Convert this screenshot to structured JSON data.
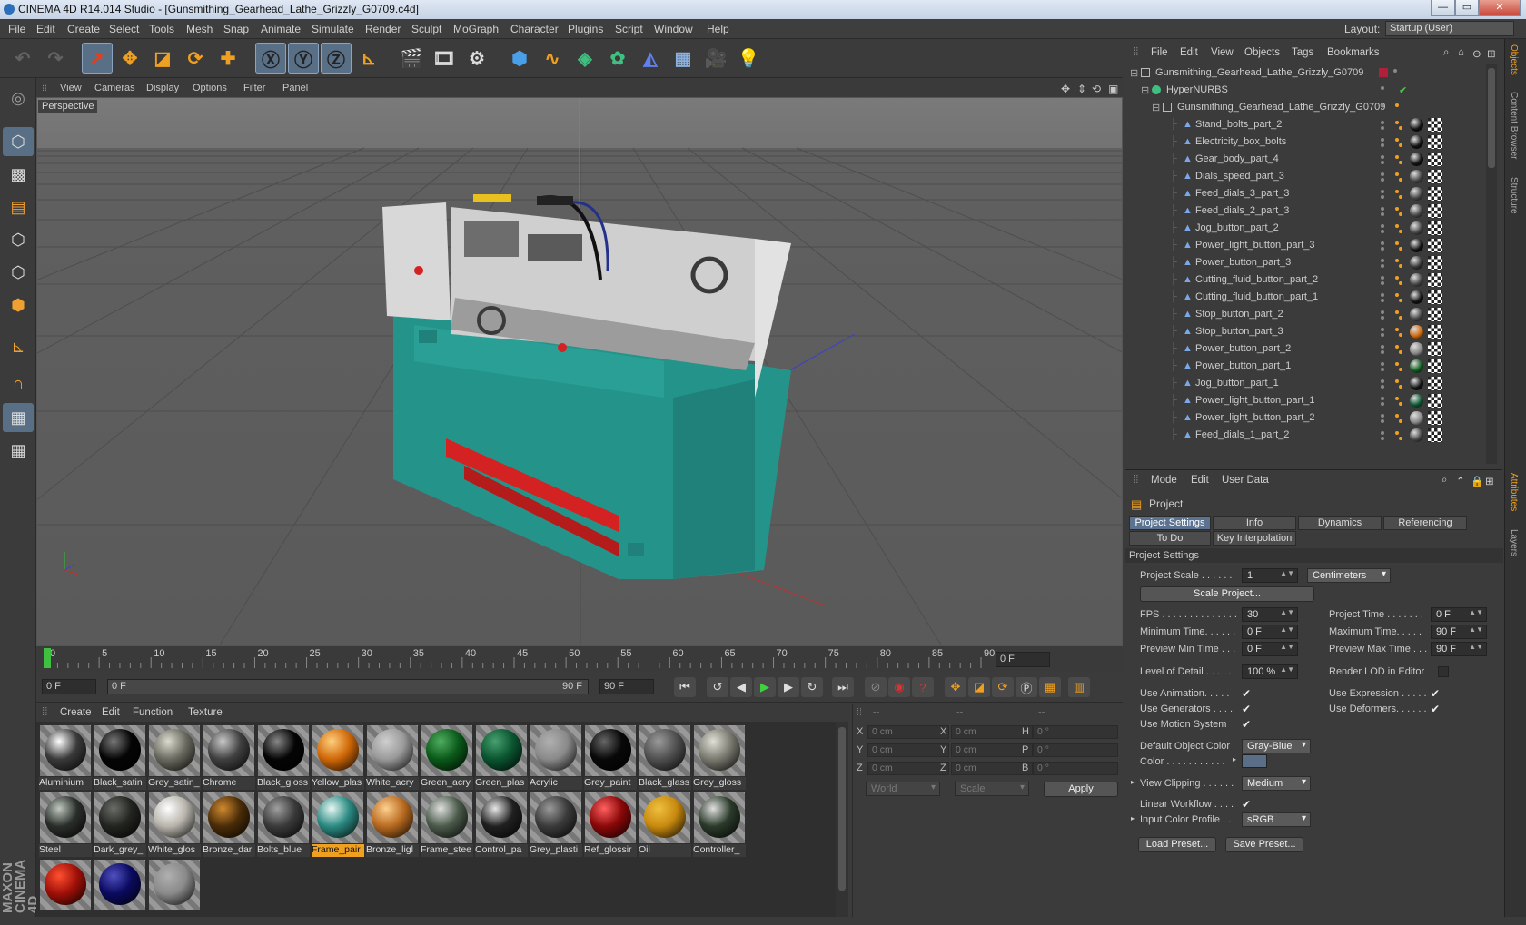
{
  "window": {
    "title": "CINEMA 4D R14.014 Studio - [Gunsmithing_Gearhead_Lathe_Grizzly_G0709.c4d]",
    "minimize": "—",
    "maximize": "▭",
    "close": "✕"
  },
  "menu": [
    "File",
    "Edit",
    "Create",
    "Select",
    "Tools",
    "Mesh",
    "Snap",
    "Animate",
    "Simulate",
    "Render",
    "Sculpt",
    "MoGraph",
    "Character",
    "Plugins",
    "Script",
    "Window",
    "Help"
  ],
  "layout": {
    "label": "Layout:",
    "value": "Startup (User)"
  },
  "toolbar": {
    "icons": [
      "undo-icon",
      "redo-icon",
      "select-arrow-icon",
      "move-icon",
      "scale-icon",
      "rotate-icon",
      "live-selection-icon",
      "x-axis-icon",
      "y-axis-icon",
      "z-axis-icon",
      "coordinate-system-icon",
      "render-view-icon",
      "render-picture-viewer-icon",
      "edit-render-settings-icon",
      "cube-icon",
      "bend-spline-icon",
      "generator-icon",
      "array-icon",
      "deformer-icon",
      "floor-icon",
      "camera-icon",
      "light-icon"
    ]
  },
  "viewport": {
    "menu": [
      "View",
      "Cameras",
      "Display",
      "Options",
      "Filter",
      "Panel"
    ],
    "label": "Perspective",
    "colors": {
      "sky": "#787878",
      "floor": "#5e5e5e",
      "body": "#2aa39a",
      "rails": "#d42222"
    }
  },
  "timeline": {
    "ticks": [
      "0",
      "5",
      "10",
      "15",
      "20",
      "25",
      "30",
      "35",
      "40",
      "45",
      "50",
      "55",
      "60",
      "65",
      "70",
      "75",
      "80",
      "85",
      "90"
    ],
    "current": "0 F"
  },
  "transport": {
    "start": "0 F",
    "range_start": "0 F",
    "range_end": "90 F",
    "end": "90 F"
  },
  "materials": {
    "menu": [
      "Create",
      "Edit",
      "Function",
      "Texture"
    ],
    "items": [
      {
        "name": "Aluminium",
        "color": "#3a3a3a",
        "hi": "#ffffff"
      },
      {
        "name": "Black_satin",
        "color": "#050505",
        "hi": "#777777"
      },
      {
        "name": "Grey_satin_",
        "color": "#6a6a60",
        "hi": "#dcdcd0"
      },
      {
        "name": "Chrome",
        "color": "#404040",
        "hi": "#c8c8c8"
      },
      {
        "name": "Black_gloss",
        "color": "#050505",
        "hi": "#888888"
      },
      {
        "name": "Yellow_plas",
        "color": "#d06808",
        "hi": "#ffd080"
      },
      {
        "name": "White_acry",
        "color": "#9a9a9a",
        "hi": "#cfcfcf"
      },
      {
        "name": "Green_acry",
        "color": "#0b5a1a",
        "hi": "#4fae5f"
      },
      {
        "name": "Green_plas",
        "color": "#0a5530",
        "hi": "#48a070"
      },
      {
        "name": "Acrylic",
        "color": "#8a8a8a",
        "hi": "#b0b0b0"
      },
      {
        "name": "Grey_paint",
        "color": "#080808",
        "hi": "#666666"
      },
      {
        "name": "Black_glass",
        "color": "#505050",
        "hi": "#9a9a9a"
      },
      {
        "name": "Grey_gloss",
        "color": "#7a7a70",
        "hi": "#e0e0d6"
      },
      {
        "name": "Steel",
        "color": "#2a2e2a",
        "hi": "#c0c8c0"
      },
      {
        "name": "Dark_grey_",
        "color": "#222420",
        "hi": "#6a6e68"
      },
      {
        "name": "White_glos",
        "color": "#b8b4ac",
        "hi": "#ffffff"
      },
      {
        "name": "Bronze_dar",
        "color": "#4a2c08",
        "hi": "#d08a30"
      },
      {
        "name": "Bolts_blue",
        "color": "#3a3a3a",
        "hi": "#a0a0a0"
      },
      {
        "name": "Frame_pair",
        "color": "#2a8a82",
        "hi": "#e8f8f4"
      },
      {
        "name": "Bronze_ligl",
        "color": "#b86a20",
        "hi": "#ffd090"
      },
      {
        "name": "Frame_stee",
        "color": "#4a5a4a",
        "hi": "#e0e0e0"
      },
      {
        "name": "Control_pa",
        "color": "#202020",
        "hi": "#e8e8e8"
      },
      {
        "name": "Grey_plasti",
        "color": "#3a3a3a",
        "hi": "#9a9a9a"
      },
      {
        "name": "Ref_glossir",
        "color": "#8a0808",
        "hi": "#ff6060"
      },
      {
        "name": "Oil",
        "color": "#c88a10",
        "hi": "#f0c040"
      },
      {
        "name": "Controller_",
        "color": "#2a3a2a",
        "hi": "#e0e0e0"
      },
      {
        "name": "",
        "color": "#a01008",
        "hi": "#ff5030"
      },
      {
        "name": "",
        "color": "#0a0a60",
        "hi": "#5050c0"
      },
      {
        "name": "",
        "color": "#8a8a8a",
        "hi": "#b0b0b0"
      }
    ]
  },
  "coords": {
    "header_a": "--",
    "header_b": "--",
    "header_c": "--",
    "rows": [
      {
        "a": "X",
        "av": "0 cm",
        "b": "X",
        "bv": "0 cm",
        "c": "H",
        "cv": "0 °"
      },
      {
        "a": "Y",
        "av": "0 cm",
        "b": "Y",
        "bv": "0 cm",
        "c": "P",
        "cv": "0 °"
      },
      {
        "a": "Z",
        "av": "0 cm",
        "b": "Z",
        "bv": "0 cm",
        "c": "B",
        "cv": "0 °"
      }
    ],
    "space": "World",
    "mode": "Scale",
    "apply": "Apply"
  },
  "objects": {
    "menu": [
      "File",
      "Edit",
      "View",
      "Objects",
      "Tags",
      "Bookmarks"
    ],
    "root": "Gunsmithing_Gearhead_Lathe_Grizzly_G0709",
    "nurbs": "HyperNURBS",
    "group": "Gunsmithing_Gearhead_Lathe_Grizzly_G0709",
    "items": [
      {
        "name": "Stand_bolts_part_2",
        "mat": "#111111"
      },
      {
        "name": "Electricity_box_bolts",
        "mat": "#111111"
      },
      {
        "name": "Gear_body_part_4",
        "mat": "#111111"
      },
      {
        "name": "Dials_speed_part_3",
        "mat": "#444444"
      },
      {
        "name": "Feed_dials_3_part_3",
        "mat": "#444444"
      },
      {
        "name": "Feed_dials_2_part_3",
        "mat": "#444444"
      },
      {
        "name": "Jog_button_part_2",
        "mat": "#444444"
      },
      {
        "name": "Power_light_button_part_3",
        "mat": "#111111"
      },
      {
        "name": "Power_button_part_3",
        "mat": "#333333"
      },
      {
        "name": "Cutting_fluid_button_part_2",
        "mat": "#444444"
      },
      {
        "name": "Cutting_fluid_button_part_1",
        "mat": "#111111"
      },
      {
        "name": "Stop_button_part_2",
        "mat": "#444444"
      },
      {
        "name": "Stop_button_part_3",
        "mat": "#d06808"
      },
      {
        "name": "Power_button_part_2",
        "mat": "#888888"
      },
      {
        "name": "Power_button_part_1",
        "mat": "#0b5a1a"
      },
      {
        "name": "Jog_button_part_1",
        "mat": "#111111"
      },
      {
        "name": "Power_light_button_part_1",
        "mat": "#0a5530"
      },
      {
        "name": "Power_light_button_part_2",
        "mat": "#888888"
      },
      {
        "name": "Feed_dials_1_part_2",
        "mat": "#444444"
      }
    ]
  },
  "attributes": {
    "menu": [
      "Mode",
      "Edit",
      "User Data"
    ],
    "title": "Project",
    "tabs": [
      "Project Settings",
      "Info",
      "Dynamics",
      "Referencing"
    ],
    "tabs2": [
      "To Do",
      "Key Interpolation"
    ],
    "section": "Project Settings",
    "project_scale": {
      "label": "Project Scale . . . . . .",
      "value": "1",
      "unit": "Centimeters"
    },
    "scale_button": "Scale Project...",
    "fps": {
      "label": "FPS . . . . . . . . . . . . . .",
      "value": "30"
    },
    "project_time": {
      "label": "Project Time . . . . . . .",
      "value": "0 F"
    },
    "min_time": {
      "label": "Minimum Time. . . . . .",
      "value": "0 F"
    },
    "max_time": {
      "label": "Maximum Time. . . . .",
      "value": "90 F"
    },
    "prev_min": {
      "label": "Preview Min Time . . .",
      "value": "0 F"
    },
    "prev_max": {
      "label": "Preview Max Time . . .",
      "value": "90 F"
    },
    "lod": {
      "label": "Level of Detail . . . . .",
      "value": "100 %"
    },
    "render_lod": "Render LOD in Editor",
    "use_animation": "Use Animation. . . . .",
    "use_expression": "Use Expression . . . . .",
    "use_generators": "Use Generators . . . .",
    "use_deformers": "Use Deformers. . . . . .",
    "use_motion": "Use Motion System",
    "default_color": {
      "label": "Default Object Color",
      "value": "Gray-Blue"
    },
    "color_label": "Color . . . . . . . . . . .",
    "color_value": "#5a6e88",
    "view_clipping": {
      "label": "View Clipping . . . . . .",
      "value": "Medium"
    },
    "linear_workflow": "Linear Workflow . . . .",
    "input_profile": {
      "label": "Input Color Profile . .",
      "value": "sRGB"
    },
    "load_preset": "Load Preset...",
    "save_preset": "Save Preset..."
  },
  "side_tabs": [
    "Objects",
    "Content Browser",
    "Structure",
    "Attributes",
    "Layers"
  ]
}
